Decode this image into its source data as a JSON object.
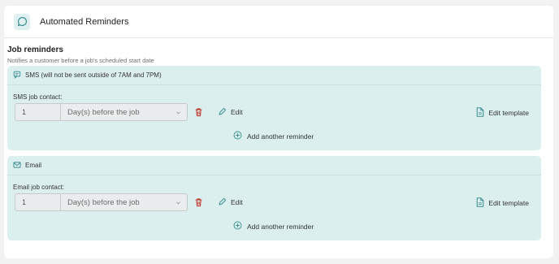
{
  "header": {
    "title": "Automated Reminders",
    "icon": "chat-bubble-icon"
  },
  "job_reminders": {
    "title": "Job reminders",
    "subtitle": "Notifies a customer before a job's scheduled start date"
  },
  "sms": {
    "heading": "SMS (will not be sent outside of 7AM and 7PM)",
    "contact_label": "SMS job contact:",
    "quantity": "1",
    "unit": "Day(s) before the job",
    "edit_label": "Edit",
    "edit_template_label": "Edit template",
    "add_label": "Add another reminder"
  },
  "email": {
    "heading": "Email",
    "contact_label": "Email job contact:",
    "quantity": "1",
    "unit": "Day(s) before the job",
    "edit_label": "Edit",
    "edit_template_label": "Edit template",
    "add_label": "Add another reminder"
  },
  "colors": {
    "panel_bg": "#dcefef",
    "accent": "#3b8f8f",
    "delete": "#c0392b"
  }
}
